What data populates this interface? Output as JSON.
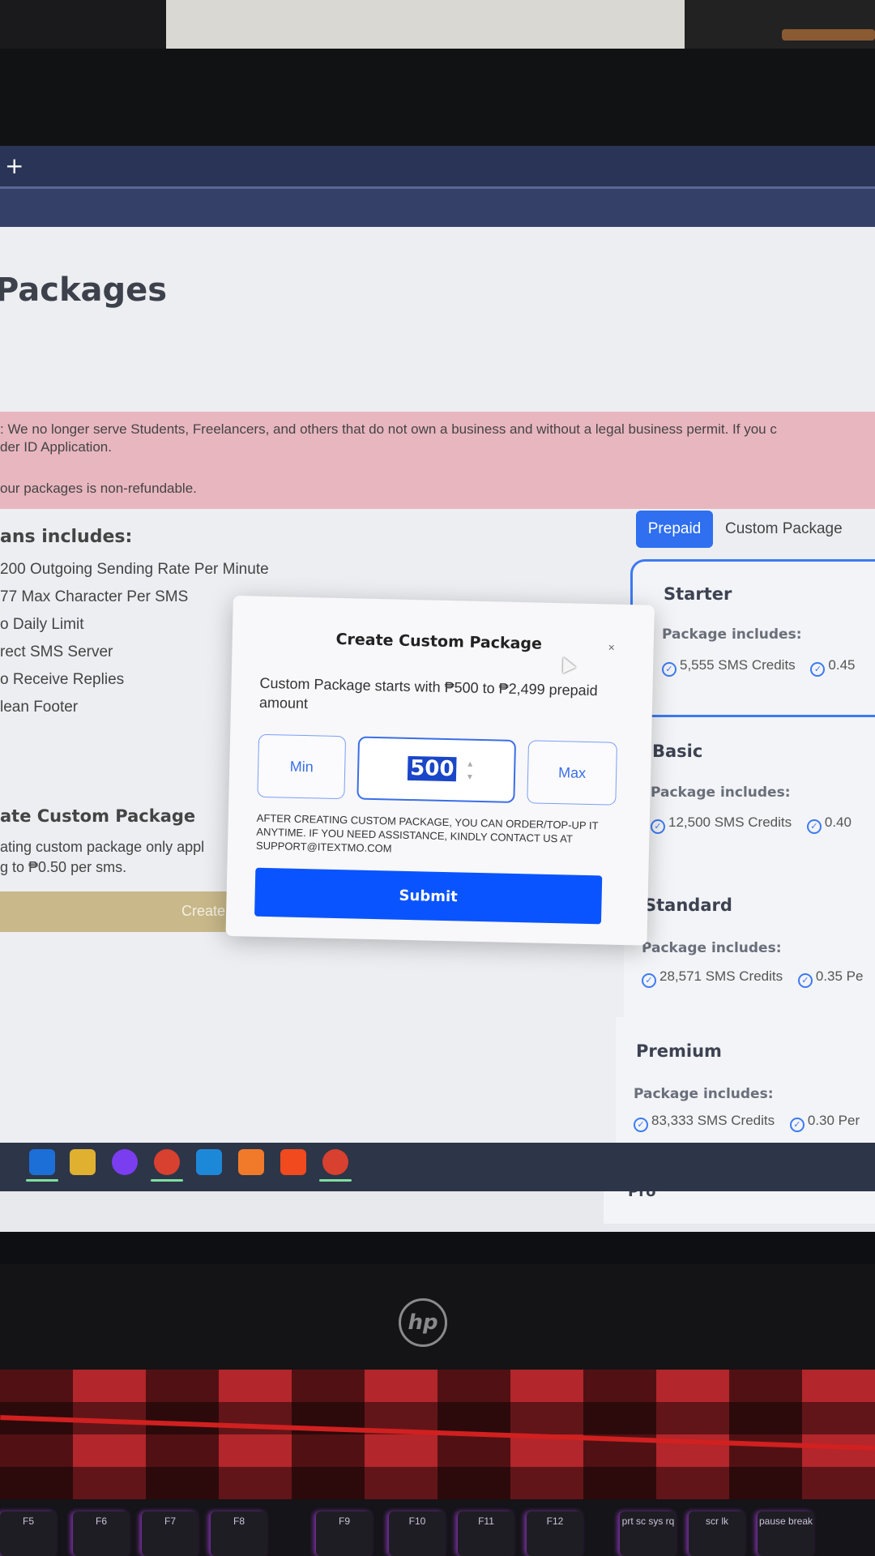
{
  "page": {
    "title": "Packages",
    "alert": {
      "line1": ": We no longer serve Students, Freelancers, and others that do not own a business and without a legal business permit. If you c",
      "line2": "der ID Application.",
      "line3": " our packages is non-refundable."
    },
    "plans_heading": "ans includes:",
    "plan_items": [
      "200 Outgoing Sending Rate Per Minute",
      "77 Max Character Per SMS",
      "o Daily Limit",
      "rect SMS Server",
      "o Receive Replies",
      "lean Footer"
    ],
    "custom_heading": "ate Custom Package",
    "custom_text_line1": "ating custom package only appl",
    "custom_text_line2": "g to ₱0.50 per sms.",
    "create_button": "Create",
    "tabs": [
      "Prepaid",
      "Custom Package"
    ],
    "packages": [
      {
        "name": "Starter",
        "includes": "Package includes:",
        "credits": "5,555 SMS Credits",
        "rate": "0.45"
      },
      {
        "name": "Basic",
        "includes": "Package includes:",
        "credits": "12,500 SMS Credits",
        "rate": "0.40"
      },
      {
        "name": "Standard",
        "includes": "Package includes:",
        "credits": "28,571 SMS Credits",
        "rate": "0.35 Pe"
      },
      {
        "name": "Premium",
        "includes": "Package includes:",
        "credits": "83,333 SMS Credits",
        "rate": "0.30 Per"
      },
      {
        "name": "Pro"
      }
    ]
  },
  "modal": {
    "title": "Create Custom Package",
    "close": "×",
    "description": "Custom Package starts with ₱500 to ₱2,499 prepaid amount",
    "min_label": "Min",
    "amount_value": "500",
    "max_label": "Max",
    "note": "After creating custom package, you can order/top-up it anytime. If you need assistance, kindly contact us at support@itextmo.com",
    "submit_label": "Submit"
  },
  "browser": {
    "new_tab": "+"
  },
  "hardware": {
    "brand": "hp",
    "keys": [
      "F5",
      "F6",
      "F7",
      "F8",
      "F9",
      "F10",
      "F11",
      "F12",
      "prt sc sys rq",
      "scr lk",
      "pause break"
    ]
  },
  "colors": {
    "accent": "#0a54ff",
    "tab_active": "#2f6ff0",
    "alert_bg": "#e8b6bf",
    "create_bg": "#c8b88a"
  }
}
